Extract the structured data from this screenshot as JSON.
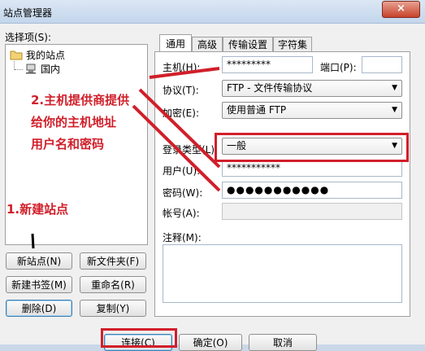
{
  "window": {
    "title": "站点管理器",
    "close": "×"
  },
  "select_label": "选择项(S):",
  "tree": {
    "root": "我的站点",
    "child": "国内"
  },
  "buttons": {
    "new_site": "新站点(N)",
    "new_folder": "新文件夹(F)",
    "new_bookmark": "新建书签(M)",
    "rename": "重命名(R)",
    "delete": "删除(D)",
    "copy": "复制(Y)",
    "connect": "连接(C)",
    "ok": "确定(O)",
    "cancel": "取消"
  },
  "tabs": [
    "通用",
    "高级",
    "传输设置",
    "字符集"
  ],
  "form": {
    "host_label": "主机(H):",
    "host_value": "*********",
    "port_label": "端口(P):",
    "port_value": "",
    "protocol_label": "协议(T):",
    "protocol_value": "FTP - 文件传输协议",
    "encryption_label": "加密(E):",
    "encryption_value": "使用普通 FTP",
    "logon_label": "登录类型(L):",
    "logon_value": "一般",
    "user_label": "用户(U):",
    "user_value": "***********",
    "password_label": "密码(W):",
    "password_value": "●●●●●●●●●●●",
    "account_label": "帐号(A):",
    "account_value": "",
    "comment_label": "注释(M):"
  },
  "annotations": {
    "step1": "1.新建站点",
    "step2_line1": "2.主机提供商提供",
    "step2_line2": "给你的主机地址",
    "step2_line3": "用户名和密码"
  },
  "colors": {
    "annotation": "#d01f2a",
    "titlebar": "#c3d6ec"
  }
}
